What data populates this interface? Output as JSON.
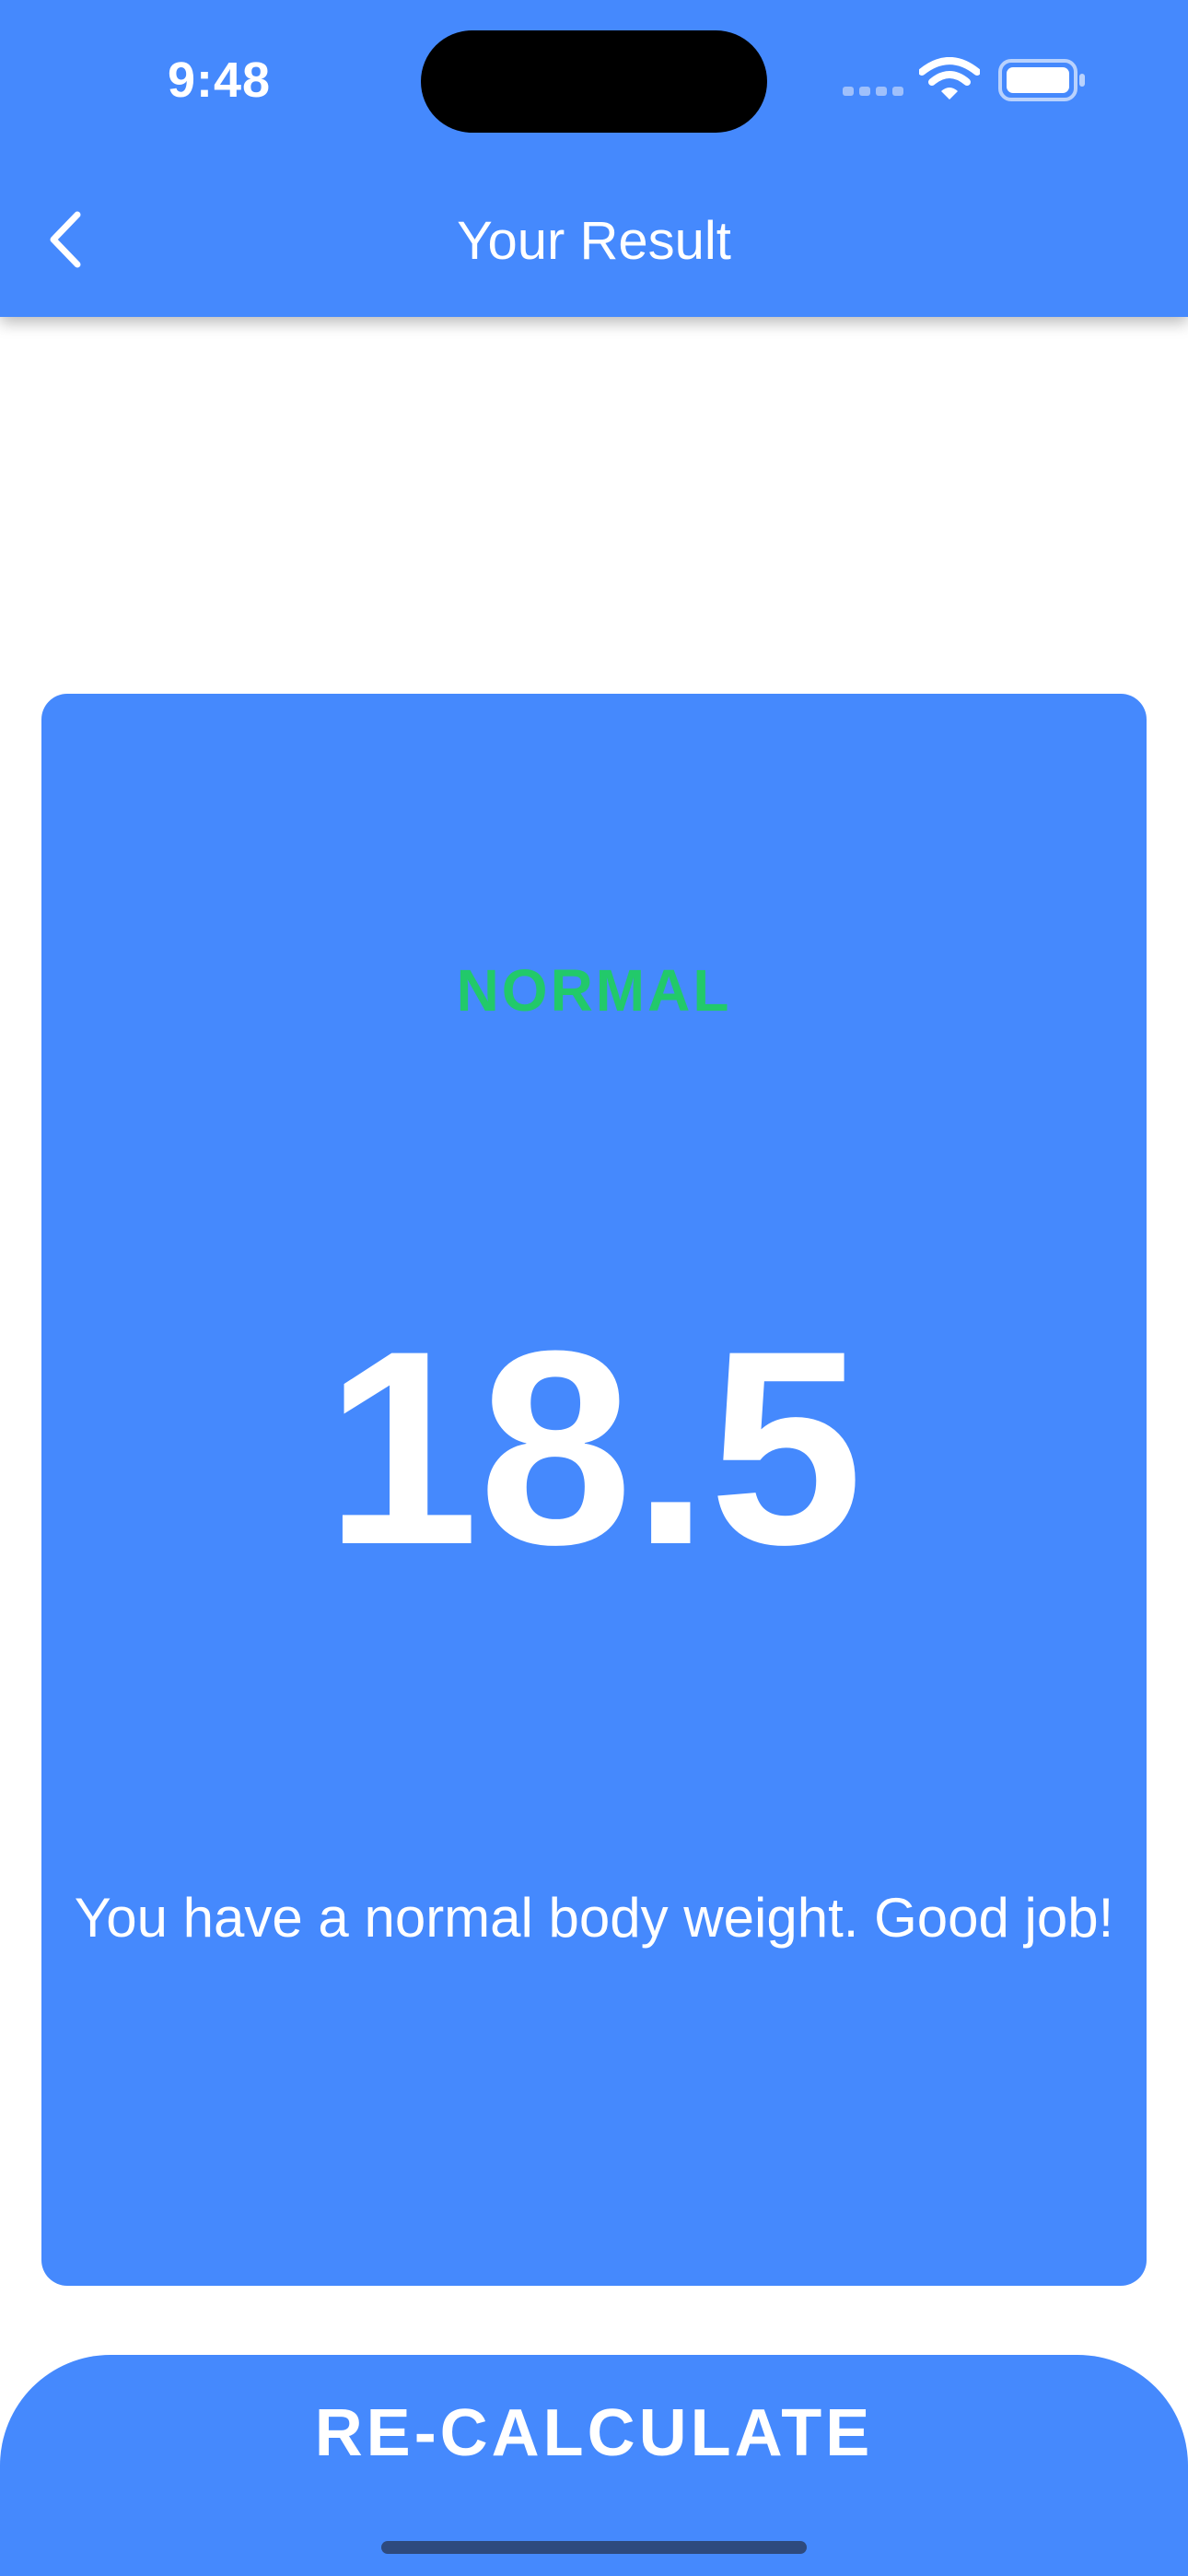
{
  "status_bar": {
    "time": "9:48",
    "icons": [
      "cellular-signal-icon",
      "wifi-icon",
      "battery-icon"
    ]
  },
  "app_bar": {
    "title": "Your Result",
    "back_icon": "chevron-left-icon"
  },
  "result": {
    "status": "NORMAL",
    "value": "18.5",
    "message": "You have a normal body weight. Good job!"
  },
  "action": {
    "label": "RE-CALCULATE"
  },
  "colors": {
    "primary": "#4589fd",
    "status_normal": "#22c96a",
    "text_on_primary": "#ffffff",
    "background": "#ffffff"
  }
}
